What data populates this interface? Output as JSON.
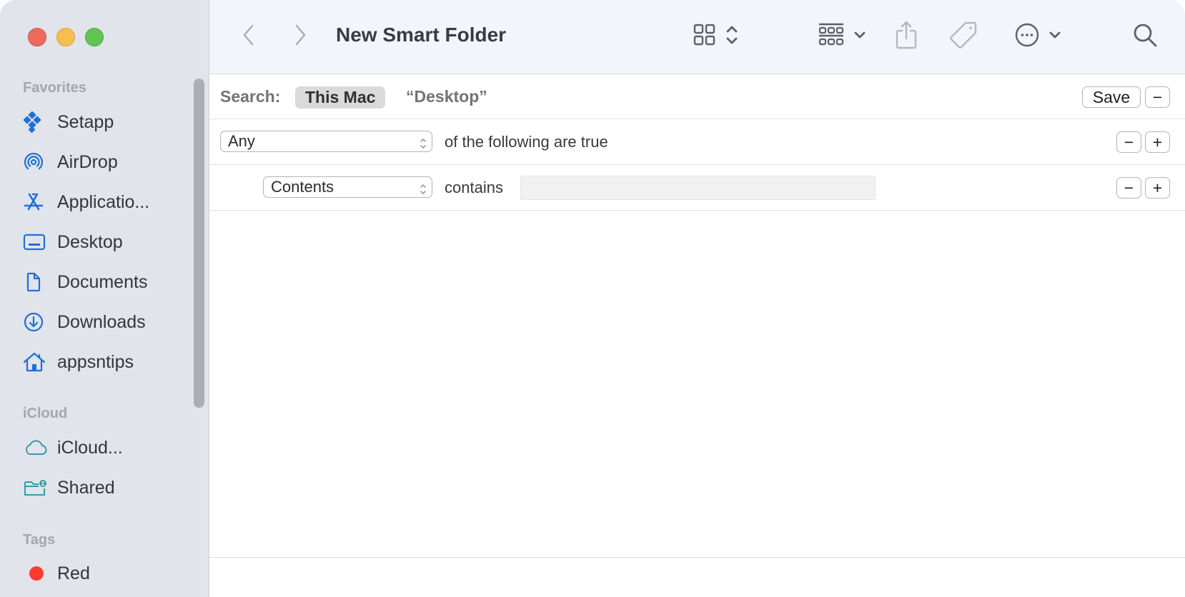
{
  "window": {
    "title": "New Smart Folder",
    "traffic_lights": [
      "close",
      "minimize",
      "zoom"
    ]
  },
  "toolbar": {
    "back_icon": "chevron-left-icon",
    "forward_icon": "chevron-right-icon",
    "view_icon": "icon-grid-icon",
    "group_icon": "group-by-icon",
    "share_icon": "share-icon",
    "tag_icon": "tag-icon",
    "more_icon": "ellipsis-circle-icon",
    "search_icon": "magnifying-glass-icon"
  },
  "sidebar": {
    "sections": [
      {
        "label": "Favorites",
        "items": [
          {
            "label": "Setapp",
            "icon": "setapp-icon"
          },
          {
            "label": "AirDrop",
            "icon": "airdrop-icon"
          },
          {
            "label": "Applicatio...",
            "icon": "applications-icon"
          },
          {
            "label": "Desktop",
            "icon": "desktop-icon"
          },
          {
            "label": "Documents",
            "icon": "document-icon"
          },
          {
            "label": "Downloads",
            "icon": "download-icon"
          },
          {
            "label": "appsntips",
            "icon": "home-icon"
          }
        ]
      },
      {
        "label": "iCloud",
        "items": [
          {
            "label": "iCloud...",
            "icon": "cloud-icon"
          },
          {
            "label": "Shared",
            "icon": "shared-folder-icon"
          }
        ]
      },
      {
        "label": "Tags",
        "items": [
          {
            "label": "Red",
            "icon": "tag-dot-icon",
            "color": "#ff3b30"
          }
        ]
      }
    ]
  },
  "search_bar": {
    "label": "Search:",
    "scope_selected": "This Mac",
    "scope_other": "“Desktop”",
    "save_label": "Save",
    "remove_symbol": "−"
  },
  "criteria": {
    "match_popup": "Any",
    "match_suffix": "of the following are true",
    "rules": [
      {
        "attribute": "Contents",
        "operator": "contains",
        "value": ""
      }
    ],
    "minus_symbol": "−",
    "plus_symbol": "+"
  },
  "colors": {
    "accent": "#1f6fd6",
    "icloud_teal": "#3a9aa8",
    "tag_red": "#ff3b30"
  }
}
